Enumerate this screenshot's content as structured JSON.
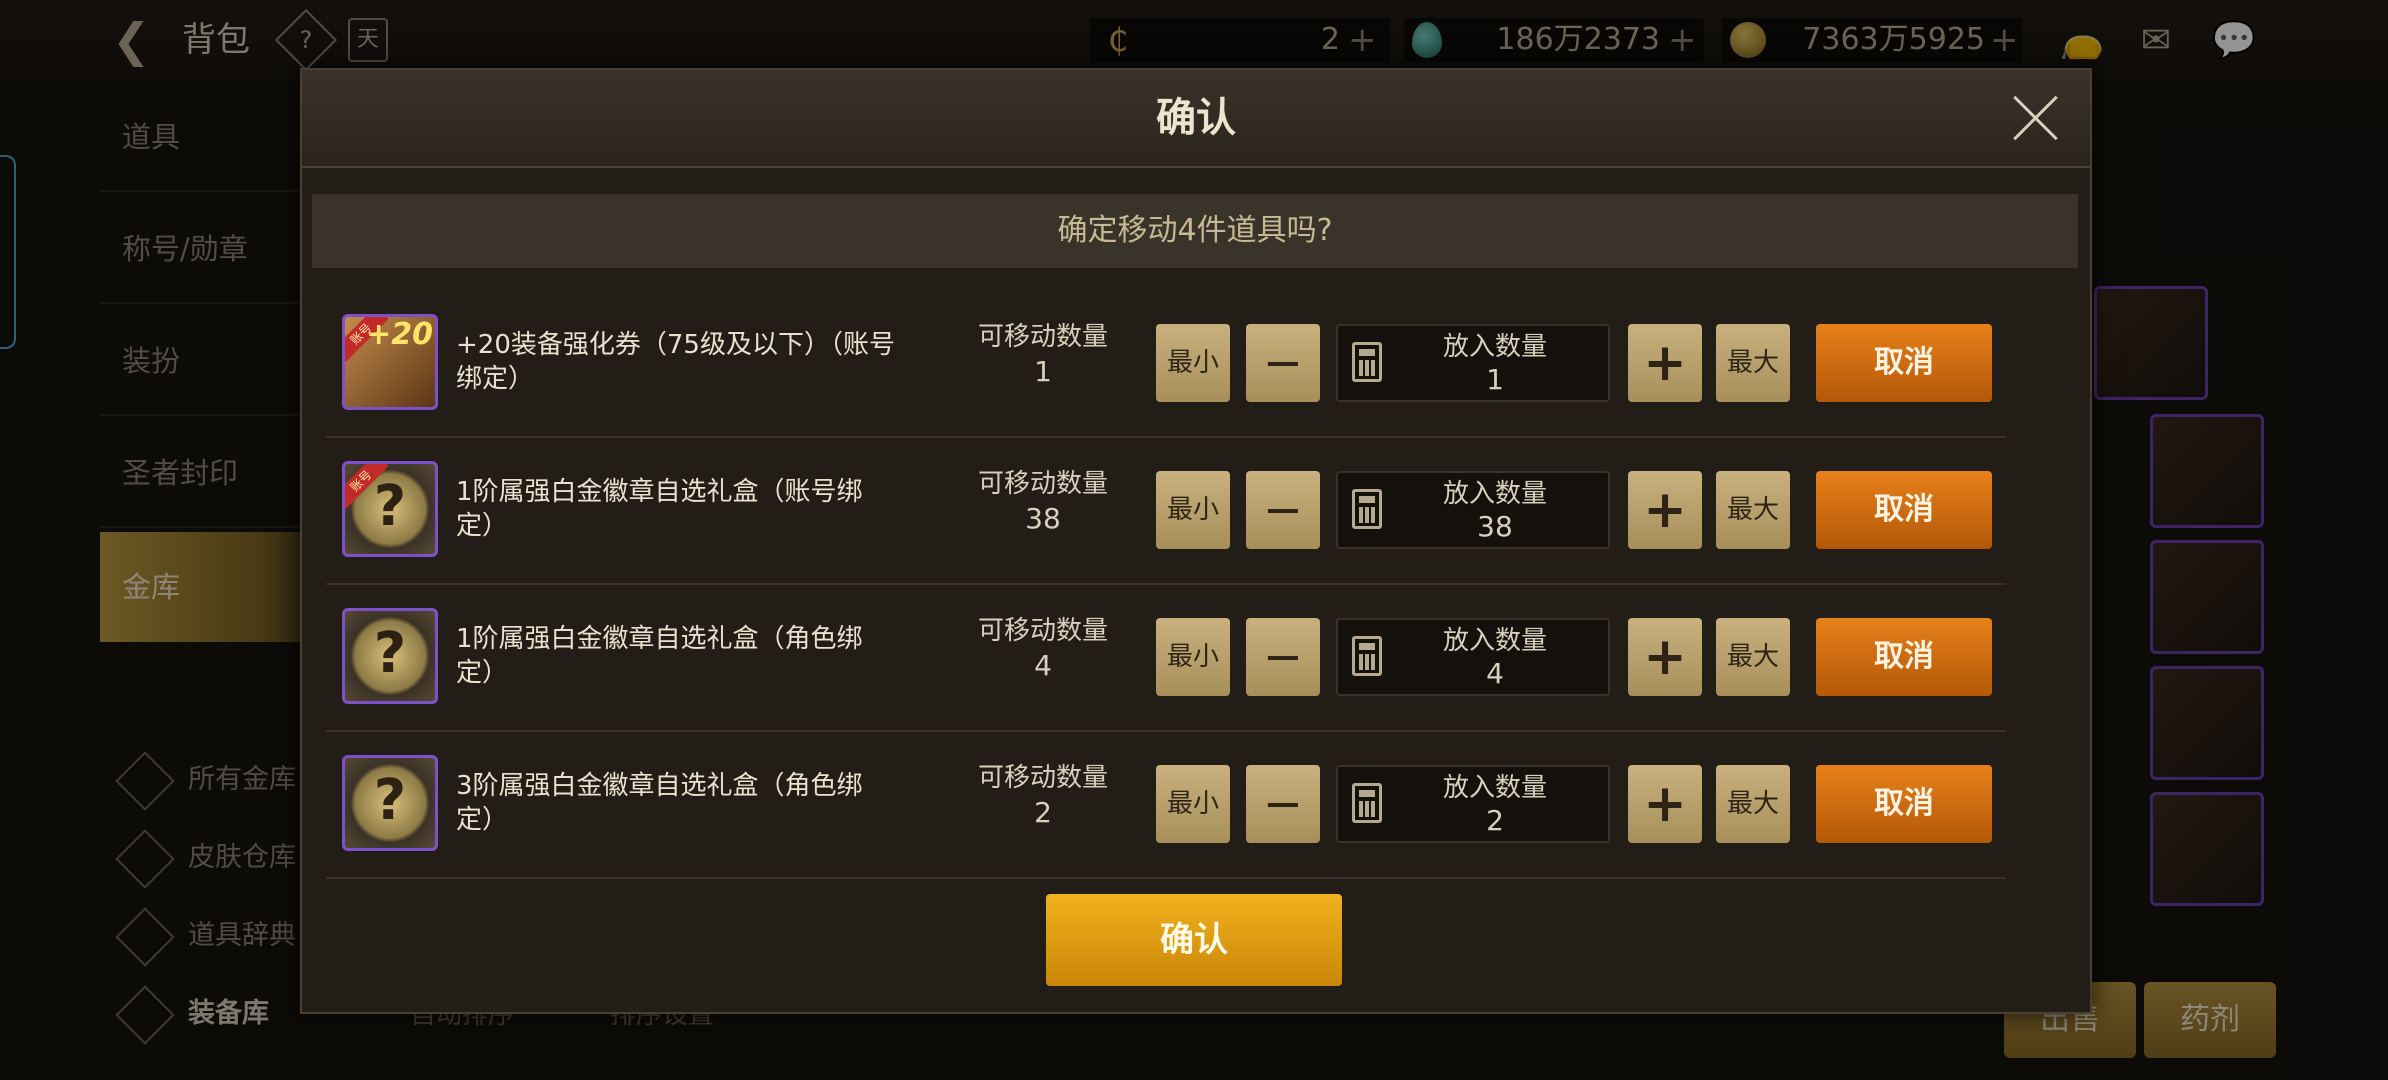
{
  "header": {
    "title": "背包",
    "back_icon": "back-arrow-icon",
    "currencies": [
      {
        "icon": "cera-icon",
        "value": "2"
      },
      {
        "icon": "gem-icon",
        "value": "186万2373"
      },
      {
        "icon": "gold-icon",
        "value": "7363万5925"
      }
    ],
    "plus": "+"
  },
  "sidebar": {
    "items": [
      {
        "label": "道具"
      },
      {
        "label": "称号/勋章"
      },
      {
        "label": "装扮"
      },
      {
        "label": "圣者封印"
      },
      {
        "label": "金库"
      }
    ],
    "links": [
      {
        "label": "所有金库"
      },
      {
        "label": "皮肤仓库"
      },
      {
        "label": "道具辞典"
      },
      {
        "label": "装备库"
      }
    ]
  },
  "bottom": {
    "auto_sort": "自动排序",
    "sort_settings": "排序设置",
    "sell": "出售",
    "potion": "药剂"
  },
  "dialog": {
    "title": "确认",
    "prompt": "确定移动4件道具吗?",
    "col_movable": "可移动数量",
    "col_put": "放入数量",
    "btn_min": "最小",
    "btn_max": "最大",
    "btn_cancel": "取消",
    "confirm": "确认",
    "rows": [
      {
        "name": "+20装备强化券（75级及以下）（账号绑定）",
        "movable": "1",
        "put": "1"
      },
      {
        "name": "1阶属强白金徽章自选礼盒（账号绑定）",
        "movable": "38",
        "put": "38"
      },
      {
        "name": "1阶属强白金徽章自选礼盒（角色绑定）",
        "movable": "4",
        "put": "4"
      },
      {
        "name": "3阶属强白金徽章自选礼盒（角色绑定）",
        "movable": "2",
        "put": "2"
      }
    ],
    "icon_badges": {
      "plus20": "+20",
      "account": "账号",
      "question": "?"
    }
  },
  "colors": {
    "accent_gold": "#f2b21d",
    "cancel_orange": "#e6801a",
    "tan_button": "#c8b17e",
    "rarity_border": "#7d52c9"
  }
}
